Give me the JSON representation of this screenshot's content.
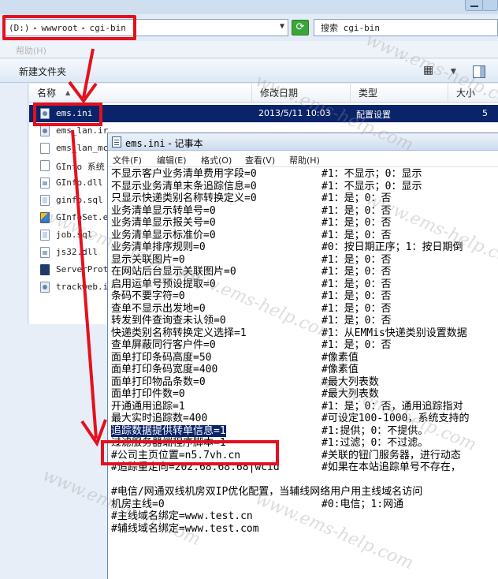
{
  "explorer": {
    "address": {
      "segments": [
        "(D:)",
        "wwwroot",
        "cgi-bin"
      ]
    },
    "search": {
      "label": "搜索 cgi-bin"
    },
    "menu": {
      "help": "帮助(H)"
    },
    "toolbar": {
      "new_folder": "新建文件夹"
    },
    "columns": {
      "name": "名称",
      "date": "修改日期",
      "type": "类型",
      "size": "大小"
    },
    "files": [
      {
        "name": "ems.ini",
        "date": "2013/5/11 10:03",
        "type": "配置设置",
        "size": "5",
        "icon": "config-file-icon",
        "selected": true
      },
      {
        "name": "ems_lan.ir",
        "date": "",
        "type": "",
        "size": "",
        "icon": "config-file-icon",
        "selected": false
      },
      {
        "name": "ems_lan_mc",
        "date": "",
        "type": "",
        "size": "",
        "icon": "file-icon",
        "selected": false
      },
      {
        "name": "GInfo 系统",
        "date": "",
        "type": "",
        "size": "",
        "icon": "file-icon",
        "selected": false
      },
      {
        "name": "GInfo.dll",
        "date": "",
        "type": "",
        "size": "",
        "icon": "dll-file-icon",
        "selected": false
      },
      {
        "name": "ginfo.sql",
        "date": "",
        "type": "",
        "size": "",
        "icon": "sql-file-icon",
        "selected": false
      },
      {
        "name": "GInfoSet.e",
        "date": "",
        "type": "",
        "size": "",
        "icon": "exe-file-icon",
        "selected": false
      },
      {
        "name": "job.sql",
        "date": "",
        "type": "",
        "size": "",
        "icon": "sql-file-icon",
        "selected": false
      },
      {
        "name": "js32.dll",
        "date": "",
        "type": "",
        "size": "",
        "icon": "dll-file-icon",
        "selected": false
      },
      {
        "name": "ServerProt",
        "date": "",
        "type": "",
        "size": "",
        "icon": "server-file-icon",
        "selected": false
      },
      {
        "name": "trackweb.i",
        "date": "",
        "type": "",
        "size": "",
        "icon": "config-file-icon",
        "selected": false
      }
    ]
  },
  "notepad": {
    "title_file": "ems.ini",
    "title_app": " - 记事本",
    "menu": [
      "文件(F)",
      "编辑(E)",
      "格式(O)",
      "查看(V)",
      "帮助(H)"
    ],
    "lines": [
      {
        "key": "不显示客户业务清单费用字段=0",
        "comment": "#1：不显示；0：显示"
      },
      {
        "key": "不显示业务清单末条追踪信息=0",
        "comment": "#1：不显示；0：显示"
      },
      {
        "key": "只显示快递类别名称转换定义=0",
        "comment": "#1：是；0：否"
      },
      {
        "key": "业务清单显示转单号=0",
        "comment": "#1：是；0：否"
      },
      {
        "key": "业务清单显示报关号=0",
        "comment": "#1：是；0：否"
      },
      {
        "key": "业务清单显示标准价=0",
        "comment": "#1：是；0：否"
      },
      {
        "key": "业务清单排序规则=0",
        "comment": "#0：按日期正序；1：按日期倒"
      },
      {
        "key": "显示关联图片=0",
        "comment": "#1：是；0：否"
      },
      {
        "key": "在网站后台显示关联图片=0",
        "comment": "#1：是；0：否"
      },
      {
        "key": "启用运单号预设提取=0",
        "comment": "#1：是；0：否"
      },
      {
        "key": "条码不要字符=0",
        "comment": "#1：是；0：否"
      },
      {
        "key": "查单不显示出发地=0",
        "comment": "#1：是；0：否"
      },
      {
        "key": "转发到件查询查未认领=0",
        "comment": "#1：是；0：否"
      },
      {
        "key": "快递类别名称转换定义选择=1",
        "comment": "#1：从EMMis快递类别设置数据"
      },
      {
        "key": "查单屏蔽同行客户件=0",
        "comment": "#1：是；0：否"
      },
      {
        "key": "面单打印条码高度=50",
        "comment": "#像素值"
      },
      {
        "key": "面单打印条码宽度=400",
        "comment": "#像素值"
      },
      {
        "key": "面单打印物品条数=0",
        "comment": "#最大列表数"
      },
      {
        "key": "面单打印件数=0",
        "comment": "#最大列表数"
      },
      {
        "key": "开通通用追踪=1",
        "comment": "#1：是；0：否，通用追踪指对"
      },
      {
        "key": "最大实时追踪数=400",
        "comment": "#可设定100-1000，系统支持的"
      },
      {
        "key": "追踪数据提供转单信息=1",
        "comment": "#1:提供；0：不提供。"
      },
      {
        "key": "过滤服务器端程序脚本=1",
        "comment": "#1:过滤；0：不过滤。"
      },
      {
        "key": "#公司主页位置=n5.7vh.cn",
        "comment": "#关联的钮门服务器，进行动态"
      },
      {
        "key": "#追踪重定向=202.68.68.68|wcid",
        "comment": "#如果在本站追踪单号不存在，"
      },
      {
        "key": "",
        "comment": ""
      },
      {
        "full": "#电信/网通双线机房双IP优化配置，当辅线网络用户用主线域名访问"
      },
      {
        "key": "机房主线=0",
        "comment": "#0:电信；1:网通"
      },
      {
        "key": "#主线域名绑定=www.test.cn",
        "comment": ""
      },
      {
        "key": "#辅线域名绑定=www.test.com",
        "comment": ""
      }
    ],
    "selected_line": 21
  },
  "watermark": "www.ems-help.com",
  "colors": {
    "highlight_red": "#e5101e",
    "selection_blue": "#0a246a",
    "refresh_green": "#3aa63a"
  }
}
